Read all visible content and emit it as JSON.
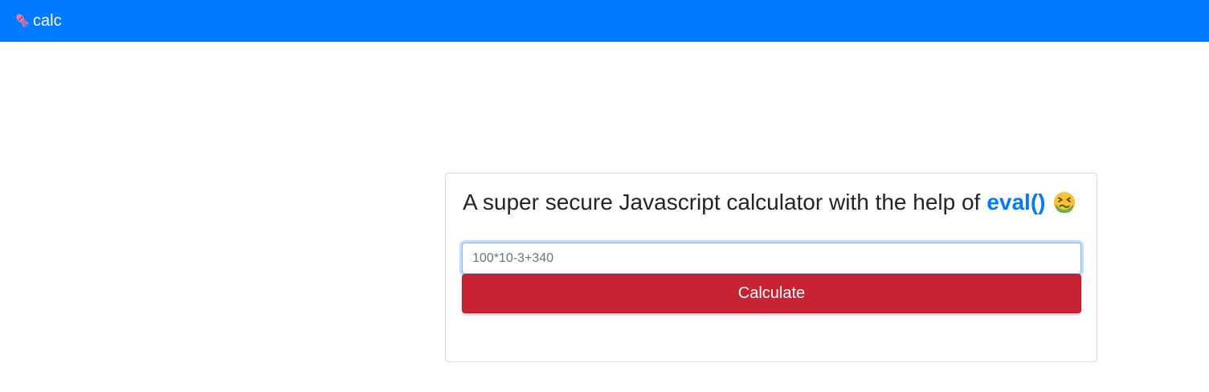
{
  "navbar": {
    "brand_label": "calc",
    "brand_icon": "squid-icon",
    "background_color": "#007bff"
  },
  "card": {
    "title_text": "A super secure Javascript calculator with the help of",
    "title_highlight": "eval()",
    "title_emoji": "nauseated-face-icon",
    "highlight_color": "#007bff"
  },
  "form": {
    "input_value": "",
    "input_placeholder": "100*10-3+340",
    "button_label": "Calculate",
    "button_color": "#c82333"
  }
}
